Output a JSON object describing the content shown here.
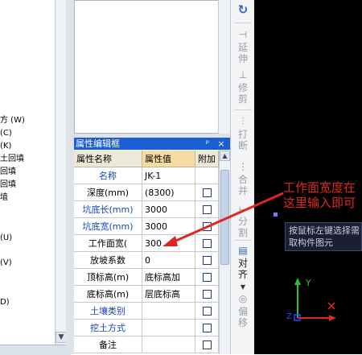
{
  "tree": {
    "items": [
      "方 (W)",
      "(C)",
      "(K)",
      "土回填",
      "回填",
      "回填",
      "埴",
      "(U)",
      "(V)",
      "D)"
    ]
  },
  "properties": {
    "title": "属性编辑框",
    "pin": "ᵖ",
    "close": "×",
    "headers": {
      "name": "属性名称",
      "value": "属性值",
      "extra": "附加"
    },
    "rows": [
      {
        "name": "名称",
        "value": "JK-1",
        "blue": true,
        "checkbox": false
      },
      {
        "name": "深度(mm)",
        "value": "(8300)",
        "blue": false,
        "checkbox": true
      },
      {
        "name": "坑底长(mm)",
        "value": "3000",
        "blue": true,
        "checkbox": true
      },
      {
        "name": "坑底宽(mm)",
        "value": "3000",
        "blue": true,
        "checkbox": true
      },
      {
        "name": "工作面宽(",
        "value": "300",
        "blue": false,
        "checkbox": true
      },
      {
        "name": "放坡系数",
        "value": "0",
        "blue": false,
        "checkbox": true
      },
      {
        "name": "顶标高(m)",
        "value": "底标高加",
        "blue": false,
        "checkbox": true
      },
      {
        "name": "底标高(m)",
        "value": "层底标高",
        "blue": false,
        "checkbox": true
      },
      {
        "name": "土壤类别",
        "value": "",
        "blue": true,
        "checkbox": true
      },
      {
        "name": "挖土方式",
        "value": "",
        "blue": true,
        "checkbox": true
      },
      {
        "name": "备注",
        "value": "",
        "blue": false,
        "checkbox": true
      }
    ]
  },
  "toolbar": {
    "extend": "延伸",
    "trim": "修剪",
    "break": "打断",
    "merge": "合并",
    "split": "分割",
    "align": "对齐",
    "offset": "偏移"
  },
  "canvas": {
    "annotation_line1": "工作面宽度在",
    "annotation_line2": "这里输入即可",
    "tooltip_line1": "按鼠标左键选择需",
    "tooltip_line2": "取构件图元",
    "axis_y": "Y",
    "axis_z": "Z"
  },
  "colors": {
    "title_bar": "#1b5ed3",
    "annotation": "#e0271f",
    "canvas": "#000000"
  }
}
